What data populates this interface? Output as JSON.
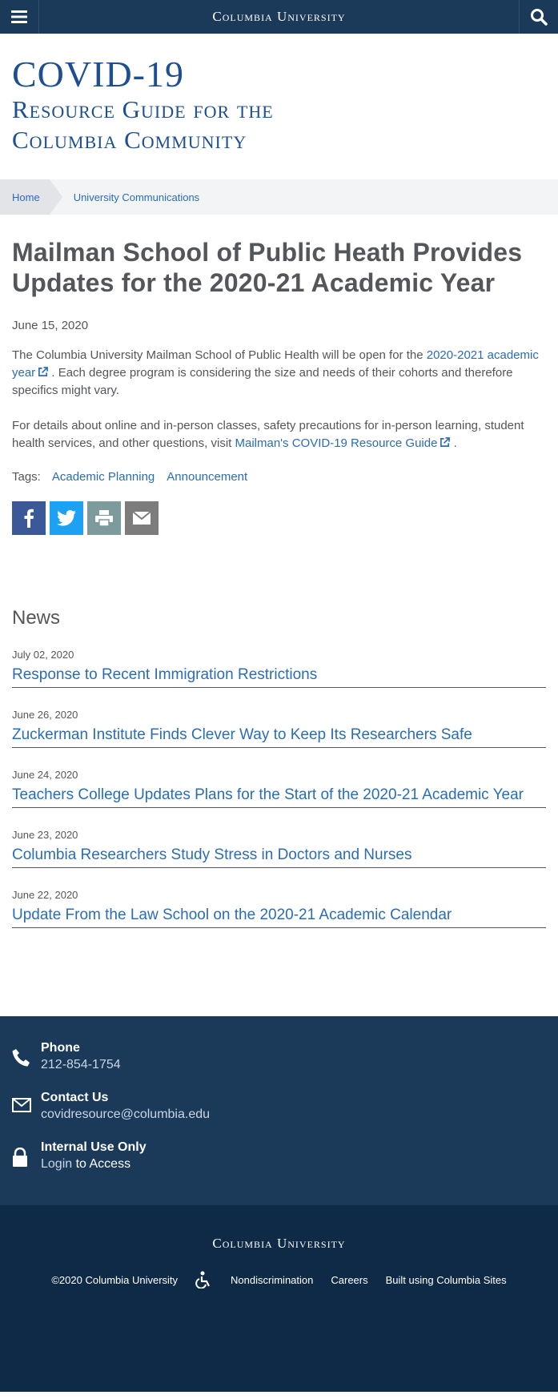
{
  "topbar": {
    "brand": "Columbia University"
  },
  "site_title": {
    "line1": "COVID-19",
    "line2": "Resource Guide for the",
    "line3": "Columbia Community"
  },
  "breadcrumb": {
    "home": "Home",
    "current": "University Communications"
  },
  "article": {
    "title": "Mailman School of Public Heath Provides Updates for the 2020-21 Academic Year",
    "date": "June 15, 2020",
    "p1_before": "The Columbia University Mailman School of Public Health will be open for the ",
    "p1_link": "2020-2021 academic year",
    "p1_after": " . Each degree program is considering the size and needs of their cohorts and therefore specifics might vary.",
    "p2_before": "For details about online and in-person classes, safety precautions for in-person learning, student health services, and other questions, visit ",
    "p2_link": "Mailman's COVID-19 Resource Guide",
    "p2_after": " .",
    "tags_label": "Tags:",
    "tags": [
      "Academic Planning",
      "Announcement"
    ]
  },
  "share": {
    "icons": [
      "facebook-icon",
      "twitter-icon",
      "print-icon",
      "email-icon"
    ]
  },
  "news": {
    "heading": "News",
    "items": [
      {
        "date": "July 02, 2020",
        "title": "Response to Recent Immigration Restrictions"
      },
      {
        "date": "June 26, 2020",
        "title": "Zuckerman Institute Finds Clever Way to Keep Its Researchers Safe"
      },
      {
        "date": "June 24, 2020",
        "title": "Teachers College Updates Plans for the Start of the 2020-21 Academic Year"
      },
      {
        "date": "June 23, 2020",
        "title": "Columbia Researchers Study Stress in Doctors and Nurses"
      },
      {
        "date": "June 22, 2020",
        "title": "Update From the Law School on the 2020-21 Academic Calendar"
      }
    ]
  },
  "contact": {
    "phone_title": "Phone",
    "phone_value": "212-854-1754",
    "email_title": "Contact Us",
    "email_value": "covidresource@columbia.edu",
    "internal_title": "Internal Use Only",
    "login_link": "Login",
    "login_suffix": " to Access"
  },
  "footer": {
    "brand": "Columbia University",
    "copyright": "©2020 Columbia University",
    "nondiscrimination": "Nondiscrimination",
    "careers": "Careers",
    "built_using": "Built using Columbia Sites"
  },
  "colors": {
    "navy": "#1b3a5a",
    "footer_navy": "#0f2a47",
    "link_blue": "#2a6db5",
    "title_blue": "#1d4f91",
    "text_gray": "#53565a"
  }
}
